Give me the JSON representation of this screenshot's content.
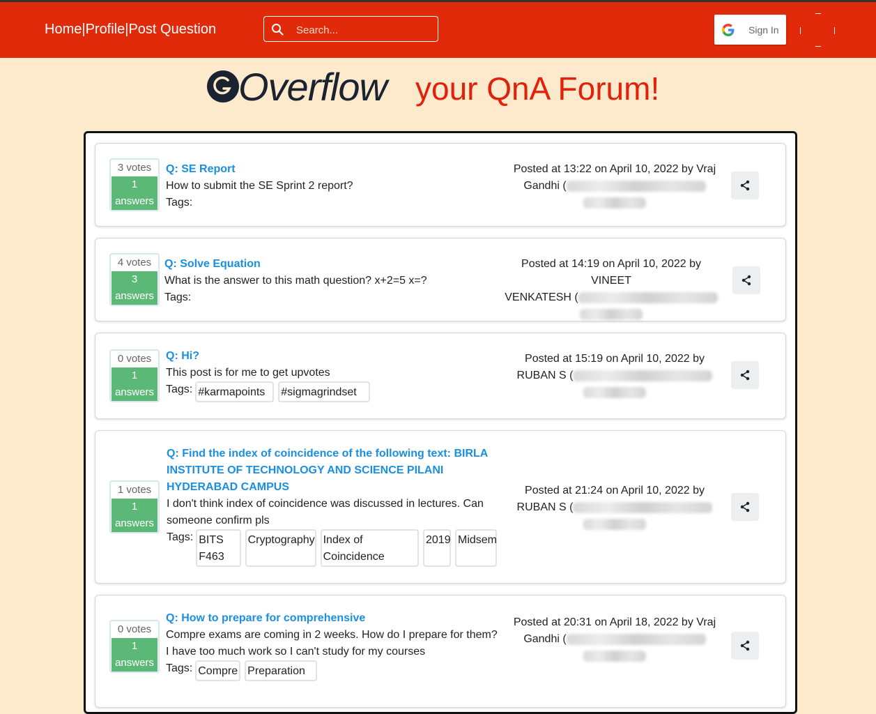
{
  "nav": {
    "home": "Home",
    "profile": "Profile",
    "post": "Post Question",
    "sep": "|",
    "search_placeholder": "Search...",
    "signin": "Sign In"
  },
  "hero": {
    "brand": "Overflow",
    "tagline": "your QnA Forum!"
  },
  "questions": [
    {
      "votes": "3 votes",
      "answers_count": "1",
      "answers_label": "answers",
      "title": "Q: SE Report",
      "body": "How to submit the SE Sprint 2 report?",
      "tags_label": "Tags:",
      "tags": [],
      "posted_line1": "Posted at 13:22 on April 10, 2022 by Vraj",
      "posted_line2": "Gandhi ("
    },
    {
      "votes": "4 votes",
      "answers_count": "3",
      "answers_label": "answers",
      "title": "Q: Solve Equation",
      "body": "What is the answer to this math question? x+2=5 x=?",
      "tags_label": "Tags:",
      "tags": [],
      "posted_line1": "Posted at 14:19 on April 10, 2022 by VINEET",
      "posted_line2": "VENKATESH ("
    },
    {
      "votes": "0 votes",
      "answers_count": "1",
      "answers_label": "answers",
      "title": "Q: Hi?",
      "body": "This post is for me to get upvotes",
      "tags_label": "Tags:",
      "tags": [
        "#karmapoints",
        "#sigmagrindset"
      ],
      "posted_line1": "Posted at 15:19 on April 10, 2022 by",
      "posted_line2": "RUBAN S ("
    },
    {
      "votes": "1 votes",
      "answers_count": "1",
      "answers_label": "answers",
      "title_lines": [
        "Q: Find the index of coincidence of the following text: BIRLA",
        "INSTITUTE OF TECHNOLOGY AND SCIENCE PILANI",
        "HYDERABAD CAMPUS"
      ],
      "body_lines": [
        "I don't think index of coincidence was discussed in lectures. Can",
        "someone confirm pls"
      ],
      "tags_label": "Tags:",
      "tags": [
        [
          "BITS",
          "F463"
        ],
        [
          "Cryptography"
        ],
        [
          "Index of",
          "Coincidence"
        ],
        [
          "2019"
        ],
        [
          "Midsem"
        ]
      ],
      "posted_line1": "Posted at 21:24 on April 10, 2022 by",
      "posted_line2": "RUBAN S ("
    },
    {
      "votes": "0 votes",
      "answers_count": "1",
      "answers_label": "answers",
      "title": "Q: How to prepare for comprehensive",
      "body_lines": [
        "Compre exams are coming in 2 weeks. How do I prepare for them?",
        "I have too much work so I can't study for my courses"
      ],
      "tags_label": "Tags:",
      "tags": [
        "Compre",
        "Preparation"
      ],
      "posted_line1": "Posted at 20:31 on April 18, 2022 by Vraj",
      "posted_line2": "Gandhi ("
    }
  ]
}
